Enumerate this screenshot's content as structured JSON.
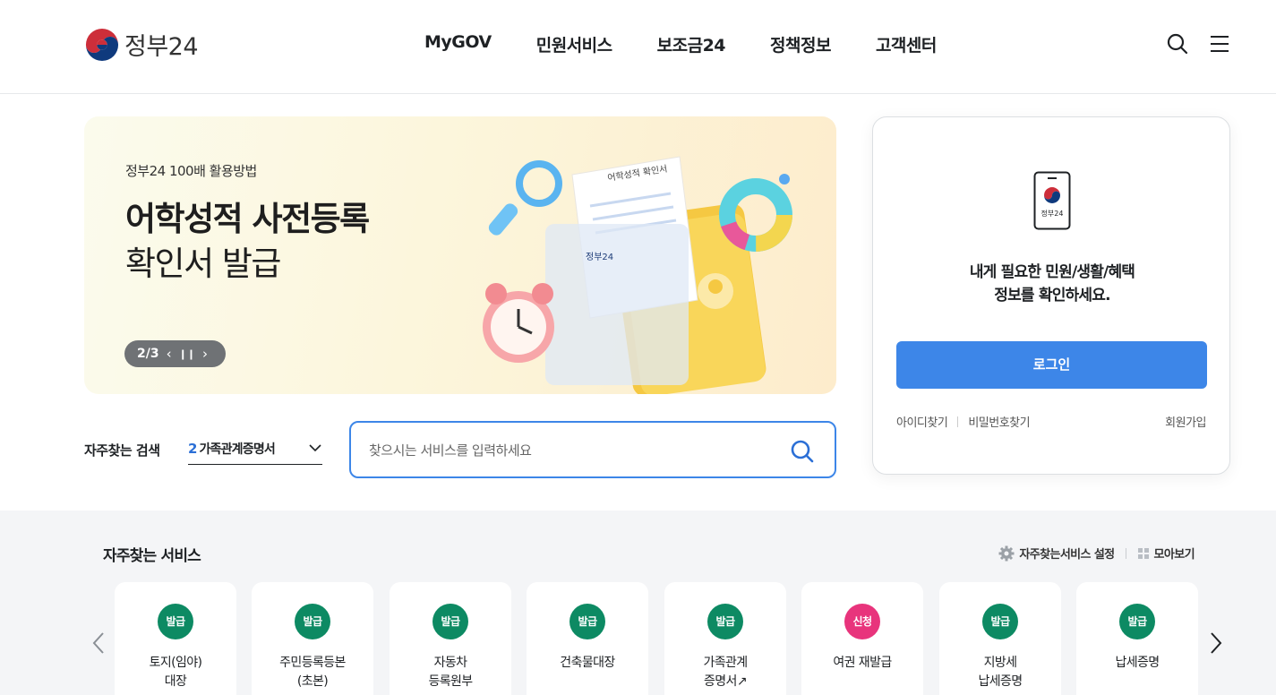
{
  "header": {
    "logo_text": "정부24",
    "nav": [
      "MyGOV",
      "민원서비스",
      "보조금24",
      "정책정보",
      "고객센터"
    ],
    "icons": [
      "search-icon",
      "menu-icon"
    ]
  },
  "banner": {
    "subtitle": "정부24 100배 활용방법",
    "title_line1": "어학성적 사전등록",
    "title_line2": "확인서 발급",
    "page": "2/3",
    "art_doc_title": "어학성적 확인서",
    "art_doc_logo": "정부24"
  },
  "login": {
    "phone_logo": "정부24",
    "message_line1": "내게 필요한 민원/생활/혜택",
    "message_line2": "정보를 확인하세요.",
    "login_button": "로그인",
    "find_id": "아이디찾기",
    "find_pw": "비밀번호찾기",
    "join": "회원가입"
  },
  "search": {
    "frequent_label": "자주찾는 검색",
    "frequent_rank": "2",
    "frequent_keyword": "가족관계증명서",
    "placeholder": "찾으시는 서비스를 입력하세요"
  },
  "services": {
    "title": "자주찾는 서비스",
    "settings_label": "자주찾는서비스 설정",
    "view_all_label": "모아보기",
    "colors": {
      "issue": "#0d8a63",
      "apply": "#e8347c"
    },
    "items": [
      {
        "badge": "발급",
        "type": "issue",
        "label": "토지(임야)\n대장"
      },
      {
        "badge": "발급",
        "type": "issue",
        "label": "주민등록등본\n(초본)"
      },
      {
        "badge": "발급",
        "type": "issue",
        "label": "자동차\n등록원부"
      },
      {
        "badge": "발급",
        "type": "issue",
        "label": "건축물대장"
      },
      {
        "badge": "발급",
        "type": "issue",
        "label": "가족관계\n증명서↗"
      },
      {
        "badge": "신청",
        "type": "apply",
        "label": "여권 재발급"
      },
      {
        "badge": "발급",
        "type": "issue",
        "label": "지방세\n납세증명"
      },
      {
        "badge": "발급",
        "type": "issue",
        "label": "납세증명"
      }
    ]
  }
}
